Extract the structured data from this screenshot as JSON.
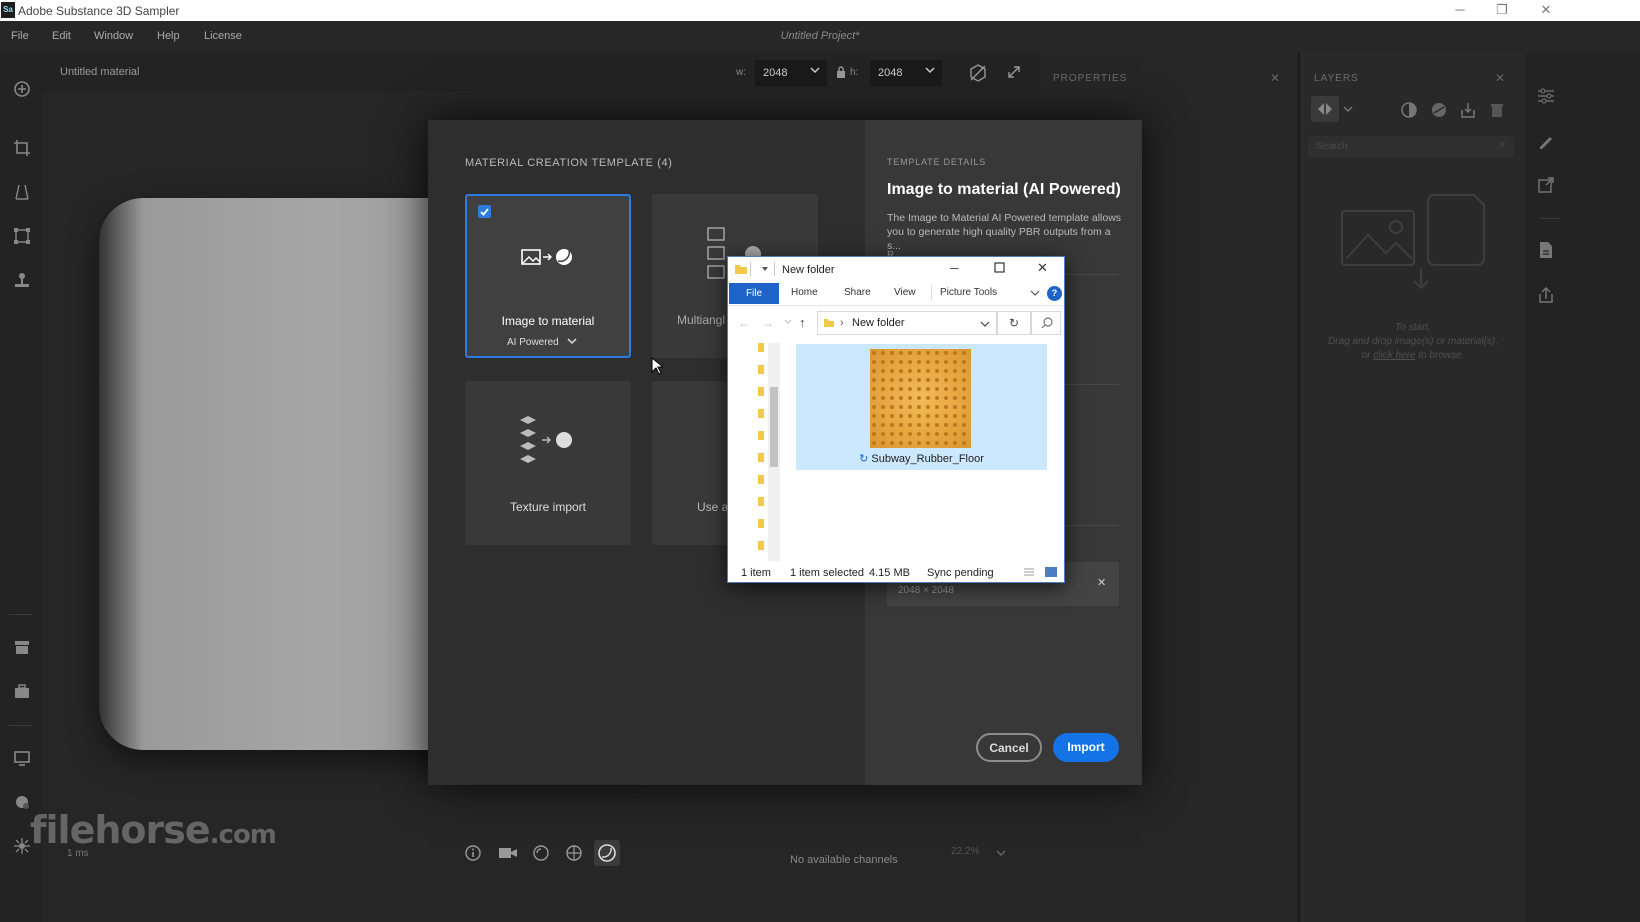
{
  "app": {
    "window_title": "Adobe Substance 3D Sampler",
    "logo_text": "Sa",
    "project_title": "Untitled Project*"
  },
  "menu": [
    "File",
    "Edit",
    "Window",
    "Help",
    "License"
  ],
  "viewport": {
    "material_name": "Untitled material",
    "width_label": "w:",
    "width_value": "2048",
    "height_label": "h:",
    "height_value": "2048",
    "render_time": "1 ms",
    "channels_status": "No available channels",
    "zoom": "22.2%"
  },
  "properties_panel": {
    "title": "PROPERTIES"
  },
  "layers_panel": {
    "title": "LAYERS",
    "search_placeholder": "Search",
    "empty_line1": "To start,",
    "empty_line2": "Drag and drop image(s) or material(s),",
    "empty_line3_prefix": "or",
    "empty_link": "click here",
    "empty_line3_suffix": "to browse."
  },
  "dialog": {
    "section_title": "MATERIAL CREATION TEMPLATE (4)",
    "templates": [
      {
        "label": "Image to material",
        "sublabel": "AI Powered",
        "selected": true
      },
      {
        "label": "Multiangl"
      },
      {
        "label": "Texture import"
      },
      {
        "label": "Use a"
      }
    ],
    "details_title": "TEMPLATE DETAILS",
    "details_heading": "Image to material (AI Powered)",
    "details_desc": "The Image to Material AI Powered template allows you to generate high quality PBR outputs from a s...",
    "details_partial": "R",
    "file_resolution": "2048 × 2048",
    "cancel_label": "Cancel",
    "import_label": "Import"
  },
  "explorer": {
    "title": "New folder",
    "tabs": [
      "File",
      "Home",
      "Share",
      "View",
      "Picture Tools"
    ],
    "help_glyph": "?",
    "address": "New folder",
    "file_name": "Subway_Rubber_Floor",
    "status_count": "1 item",
    "status_selected": "1 item selected",
    "status_size": "4.15 MB",
    "status_sync": "Sync pending"
  },
  "watermark": {
    "text": "filehorse",
    "suffix": ".com"
  },
  "colors": {
    "accent": "#1473e6",
    "selected_border": "#2d7be0",
    "file_tab": "#1d63c8",
    "selection_bg": "#cce8ff",
    "texture_orange": "#e8a43a"
  }
}
